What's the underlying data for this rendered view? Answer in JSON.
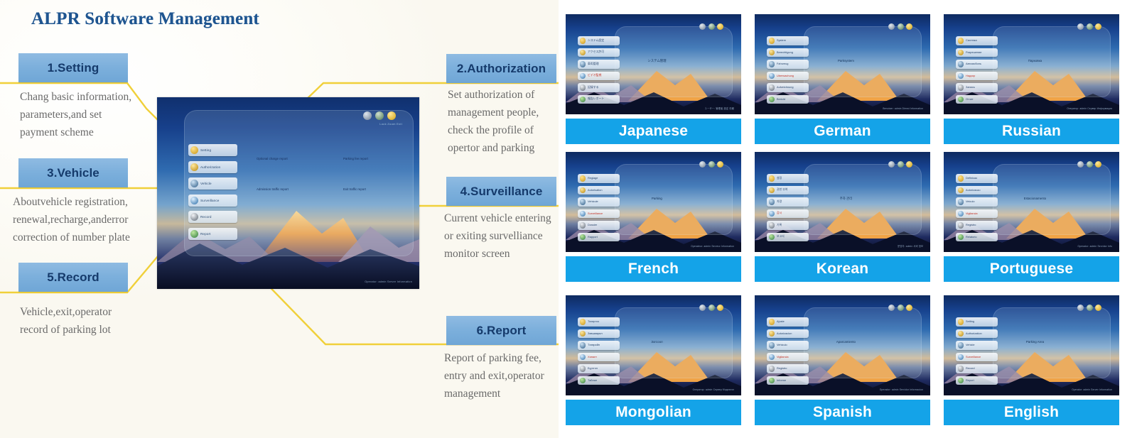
{
  "left": {
    "title": "ALPR Software Management",
    "blocks": [
      {
        "heading": "1.Setting",
        "desc": "Chang basic information,\nparameters,and set\npayment scheme"
      },
      {
        "heading": "3.Vehicle",
        "desc": "Aboutvehicle registration,\nrenewal,recharge,anderror\ncorrection of number plate"
      },
      {
        "heading": "5.Record",
        "desc": "Vehicle,exit,operator\nrecord of parking lot"
      },
      {
        "heading": "2.Authorization",
        "desc": "Set authorization of\nmanagement people,\ncheck the profile of\nopertor and parking"
      },
      {
        "heading": "4.Surveillance",
        "desc": "Current vehicle entering\nor exiting survelliance\nmonitor screen"
      },
      {
        "heading": "6.Report",
        "desc": "Report of parking fee,\nentry and exit,operator\nmanagement"
      }
    ],
    "screenshot": {
      "menu": [
        "Setting",
        "Authorization",
        "Vehicle",
        "Surveillance",
        "Record",
        "Report"
      ],
      "links": [
        "Optional charge report",
        "Parking fee report",
        "Admission traffic report",
        "Exit traffic report"
      ],
      "top_icons_caption": "Lock  Zoom  Exit",
      "footer": "Operator: admin   Server   Information"
    }
  },
  "right": {
    "cards": [
      {
        "label": "Japanese",
        "menu": [
          "システム設定",
          "アクセス許可",
          "車両管理",
          "ビデオ監視",
          "記録する",
          "報告レポート"
        ],
        "center": "システム管理",
        "footer": "ユーザー: 管理者  設定  情報"
      },
      {
        "label": "German",
        "menu": [
          "System",
          "Berechtigung",
          "Fahrzeug",
          "Uberwachung",
          "Aufzeichnung",
          "Bericht"
        ],
        "center": "Parksystem",
        "footer": "Benutzer: admin  Dienst  Information"
      },
      {
        "label": "Russian",
        "menu": [
          "Система",
          "Разрешение",
          "Автомобиль",
          "Надзор",
          "Запись",
          "Отчет"
        ],
        "center": "Парковка",
        "footer": "Оператор: admin  Сервер  Информация"
      },
      {
        "label": "French",
        "menu": [
          "Reglage",
          "Autorisation",
          "Vehicule",
          "Surveillance",
          "Dossier",
          "Rapport"
        ],
        "center": "Parking",
        "footer": "Operateur: admin  Serveur  Information"
      },
      {
        "label": "Korean",
        "menu": [
          "설정",
          "권한 부여",
          "차량",
          "감시",
          "기록",
          "보고서"
        ],
        "center": "주차 관리",
        "footer": "운영자: admin  서버  정보"
      },
      {
        "label": "Portuguese",
        "menu": [
          "Definicao",
          "Autorizacao",
          "Veiculo",
          "Vigilancia",
          "Registro",
          "Relatorio"
        ],
        "center": "Estacionamento",
        "footer": "Operador: admin  Servidor  Info"
      },
      {
        "label": "Mongolian",
        "menu": [
          "Тохиргоо",
          "Зөвшөөрөл",
          "Тээврийн",
          "Хяналт",
          "Бүртгэл",
          "Тайлан"
        ],
        "center": "Зогсоол",
        "footer": "Оператор: admin  Сервер  Мэдээлэл"
      },
      {
        "label": "Spanish",
        "menu": [
          "Ajuste",
          "Autorizacion",
          "Vehiculo",
          "Vigilancia",
          "Registro",
          "Informe"
        ],
        "center": "Aparcamiento",
        "footer": "Operador: admin  Servidor  Informacion"
      },
      {
        "label": "English",
        "menu": [
          "Setting",
          "Authorization",
          "Vehicle",
          "Surveillance",
          "Record",
          "Report"
        ],
        "center": "Parking Area",
        "footer": "Operator: admin  Server  Information"
      }
    ]
  },
  "colors": {
    "title": "#1f5590",
    "heading_box": "#7db0dc",
    "heading_text": "#153a6b",
    "desc_text": "#6a6a6a",
    "connector": "#f2d335",
    "label_bar": "#14a3e8",
    "label_text": "#ffffff"
  }
}
